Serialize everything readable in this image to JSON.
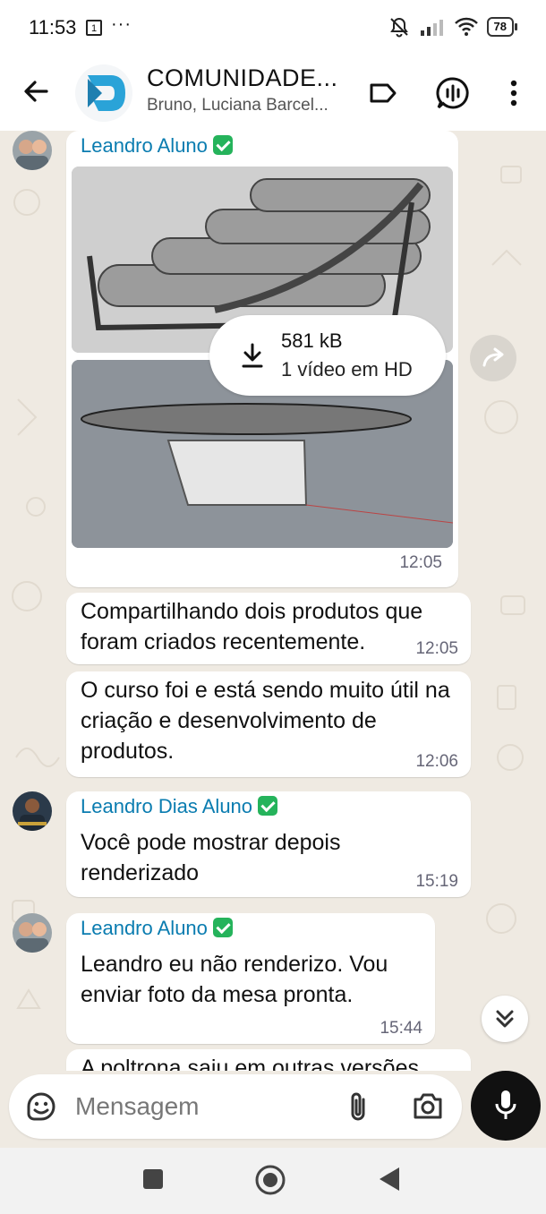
{
  "status_bar": {
    "time": "11:53",
    "notification_badge": "1",
    "overflow": "···",
    "battery": "78"
  },
  "header": {
    "title": "COMUNIDADE...",
    "subtitle": "Bruno, Luciana Barcel..."
  },
  "messages": [
    {
      "sender": "Leandro Aluno",
      "media": {
        "size": "581 kB",
        "description": "1 vídeo em HD"
      },
      "time": "12:05"
    },
    {
      "text": "Compartilhando dois produtos que foram criados  recentemente.",
      "time": "12:05"
    },
    {
      "text": "O curso foi e está sendo muito útil na criação e desenvolvimento de produtos.",
      "time": "12:06"
    },
    {
      "sender": "Leandro Dias Aluno",
      "text": "Você pode mostrar depois renderizado",
      "time": "15:19"
    },
    {
      "sender": "Leandro Aluno",
      "text": "Leandro eu não renderizo. Vou enviar foto da mesa pronta.",
      "time": "15:44"
    },
    {
      "text": "A poltrona saiu em outras versões"
    }
  ],
  "composer": {
    "placeholder": "Mensagem"
  },
  "colors": {
    "sender_name": "#0a7cb0",
    "verified_badge": "#25b35b",
    "chat_background": "#efeae2",
    "bubble": "#ffffff"
  },
  "icons": {
    "back": "arrow-left-icon",
    "label": "label-icon",
    "voice_chat": "voice-chat-icon",
    "menu": "more-vert-icon",
    "download": "download-icon",
    "forward": "forward-icon",
    "scroll_down": "chevron-double-down-icon",
    "sticker": "sticker-icon",
    "attach": "paperclip-icon",
    "camera": "camera-icon",
    "mic": "mic-icon"
  }
}
